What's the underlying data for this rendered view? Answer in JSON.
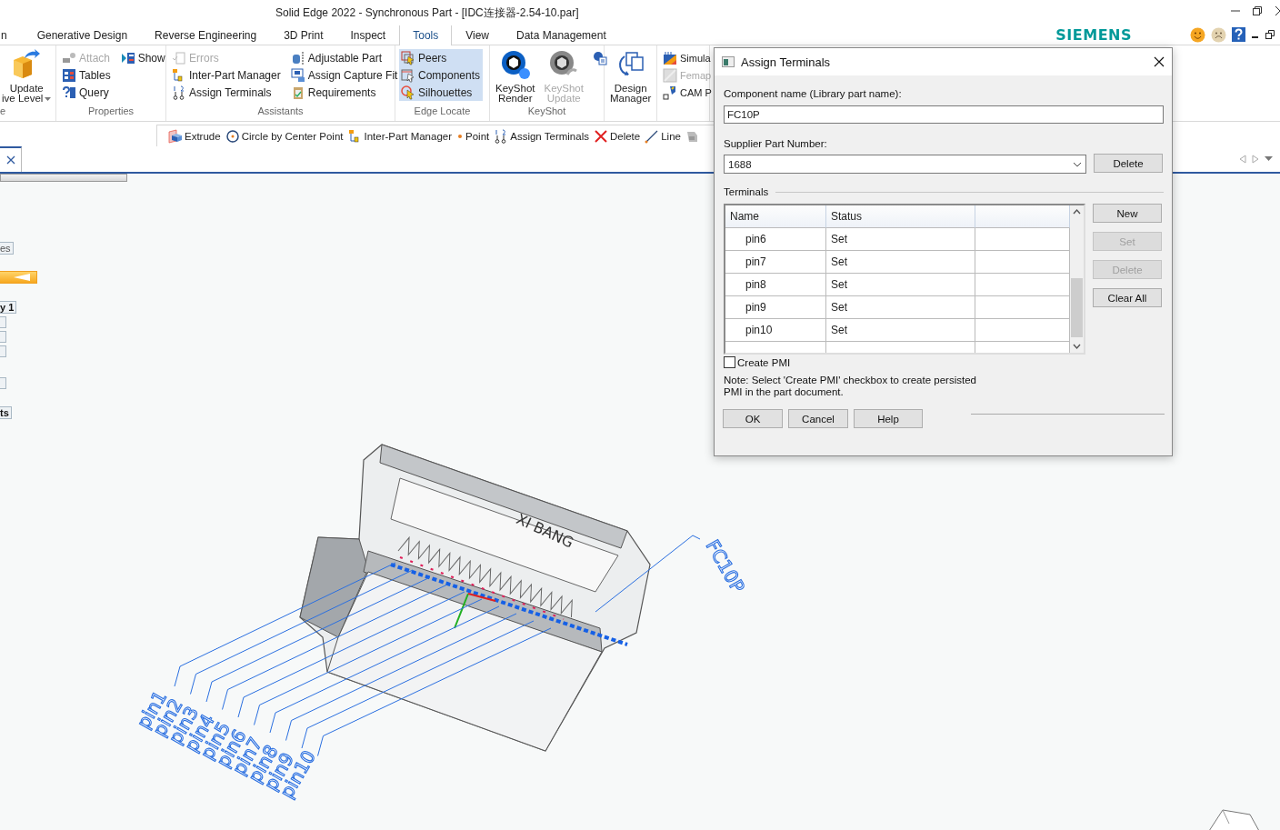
{
  "window": {
    "title": "Solid Edge 2022 - Synchronous Part - [IDC连接器-2.54-10.par]"
  },
  "ribbon_tabs": [
    {
      "label": "n",
      "selected": false
    },
    {
      "label": "Generative Design",
      "selected": false
    },
    {
      "label": "Reverse Engineering",
      "selected": false
    },
    {
      "label": "3D Print",
      "selected": false
    },
    {
      "label": "Inspect",
      "selected": false
    },
    {
      "label": "Tools",
      "selected": true
    },
    {
      "label": "View",
      "selected": false
    },
    {
      "label": "Data Management",
      "selected": false
    }
  ],
  "brand": "SIEMENS",
  "ribbon_groups": [
    {
      "label": "e",
      "columns": [
        [
          {
            "kind": "large",
            "lines": [
              "Update",
              "ive Level"
            ],
            "menu": true,
            "disabled": false
          }
        ]
      ]
    },
    {
      "label": "Properties",
      "columns": [
        [
          {
            "kind": "small",
            "label": "Attach",
            "disabled": true
          },
          {
            "kind": "small",
            "label": "Tables",
            "disabled": false
          },
          {
            "kind": "small",
            "label": "Query",
            "disabled": false
          }
        ],
        [
          {
            "kind": "small",
            "label": "Show",
            "disabled": false
          }
        ]
      ]
    },
    {
      "label": "Assistants",
      "columns": [
        [
          {
            "kind": "small",
            "label": "Errors",
            "disabled": true
          },
          {
            "kind": "small",
            "label": "Inter-Part Manager",
            "disabled": false
          },
          {
            "kind": "small",
            "label": "Assign Terminals",
            "disabled": false
          }
        ],
        [
          {
            "kind": "small",
            "label": "Adjustable Part",
            "disabled": false
          },
          {
            "kind": "small",
            "label": "Assign Capture Fit",
            "disabled": false
          },
          {
            "kind": "small",
            "label": "Requirements",
            "disabled": false
          }
        ]
      ]
    },
    {
      "label": "Edge Locate",
      "columns": [
        [
          {
            "kind": "small",
            "label": "Peers",
            "disabled": false,
            "on": true
          },
          {
            "kind": "small",
            "label": "Components",
            "disabled": false,
            "on": true
          },
          {
            "kind": "small",
            "label": "Silhouettes",
            "disabled": false,
            "on": true
          }
        ]
      ]
    },
    {
      "label": "KeyShot",
      "columns": [
        [
          {
            "kind": "large",
            "lines": [
              "KeyShot",
              "Render"
            ],
            "disabled": false
          }
        ],
        [
          {
            "kind": "large",
            "lines": [
              "KeyShot",
              "Update"
            ],
            "disabled": true
          }
        ],
        [
          {
            "kind": "icon"
          }
        ]
      ]
    },
    {
      "columns": [
        [
          {
            "kind": "large",
            "lines": [
              "Design",
              "Manager"
            ],
            "disabled": false
          }
        ]
      ]
    },
    {
      "columns": [
        [
          {
            "kind": "small",
            "label": "Simula",
            "disabled": false
          },
          {
            "kind": "small",
            "label": "Femap",
            "disabled": true
          },
          {
            "kind": "small",
            "label": "CAM P",
            "disabled": false
          }
        ]
      ]
    }
  ],
  "command_bar": [
    {
      "kind": "command",
      "label": "Extrude"
    },
    {
      "kind": "command",
      "label": "Circle by Center Point"
    },
    {
      "kind": "command",
      "label": "Inter-Part Manager"
    },
    {
      "kind": "command",
      "label": "Point"
    },
    {
      "kind": "command",
      "label": "Assign Terminals"
    },
    {
      "kind": "command",
      "label": "Delete"
    },
    {
      "kind": "command",
      "label": "Line"
    },
    {
      "kind": "icon"
    }
  ],
  "left_pane": [
    {
      "kind": "button",
      "label": "es"
    },
    {
      "kind": "bar"
    },
    {
      "kind": "header",
      "label": "y 1"
    },
    {
      "kind": "box"
    },
    {
      "kind": "box"
    },
    {
      "kind": "box"
    },
    {
      "kind": "gap"
    },
    {
      "kind": "box"
    },
    {
      "kind": "header",
      "label": "ts"
    }
  ],
  "model": {
    "engraving": "XI BANG",
    "component_label": "FC10P",
    "pin_labels": [
      "pin1",
      "pin2",
      "pin3",
      "pin4",
      "pin5",
      "pin6",
      "pin7",
      "pin8",
      "pin9",
      "pin10"
    ]
  },
  "dialog": {
    "title": "Assign Terminals",
    "component_name_label": "Component name (Library part name):",
    "component_name": "FC10P",
    "supplier_label": "Supplier Part Number:",
    "supplier_value": "1688",
    "supplier_delete": "Delete",
    "terminals_label": "Terminals",
    "columns": [
      "Name",
      "Status"
    ],
    "rows": [
      {
        "name": "pin6",
        "status": "Set"
      },
      {
        "name": "pin7",
        "status": "Set"
      },
      {
        "name": "pin8",
        "status": "Set"
      },
      {
        "name": "pin9",
        "status": "Set"
      },
      {
        "name": "pin10",
        "status": "Set"
      }
    ],
    "side_buttons": [
      {
        "label": "New",
        "disabled": false
      },
      {
        "label": "Set",
        "disabled": true
      },
      {
        "label": "Delete",
        "disabled": true
      },
      {
        "label": "Clear All",
        "disabled": false
      }
    ],
    "create_pmi": {
      "label": "Create PMI",
      "checked": false
    },
    "note": "Note: Select 'Create PMI' checkbox to create persisted PMI in the part document.",
    "buttons": [
      "OK",
      "Cancel",
      "Help"
    ]
  }
}
